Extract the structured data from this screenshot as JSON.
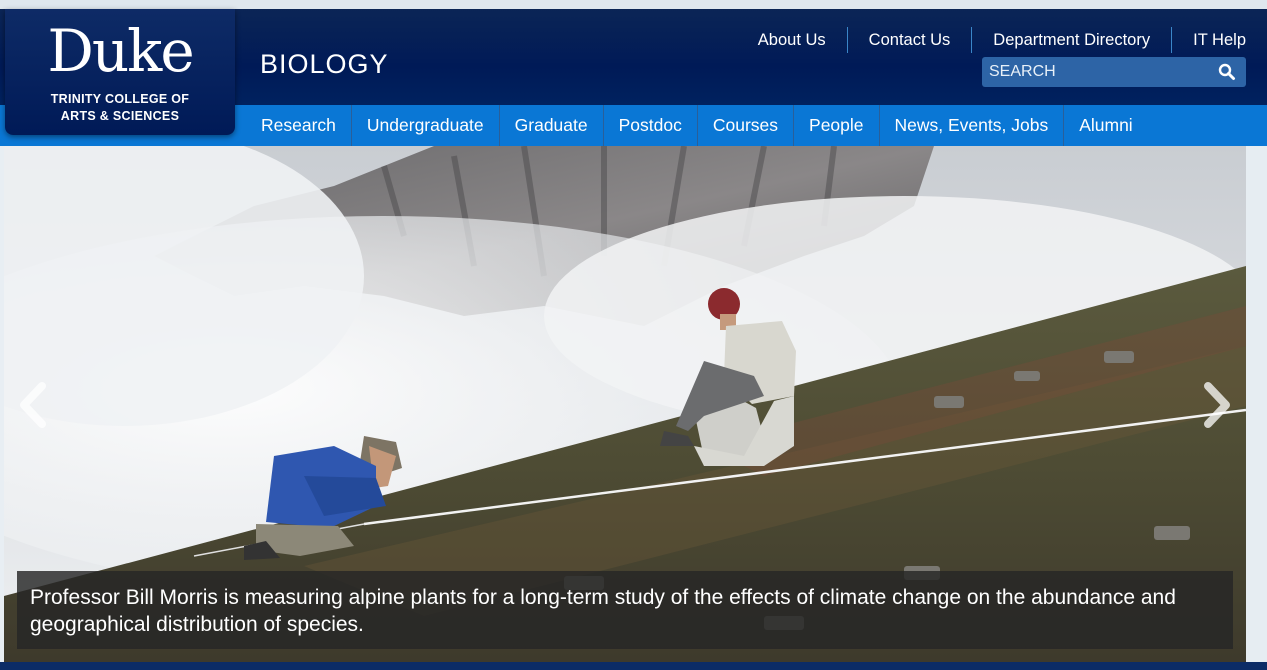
{
  "logo": {
    "wordmark": "Duke",
    "subtitle_line1": "TRINITY COLLEGE OF",
    "subtitle_line2": "ARTS & SCIENCES"
  },
  "site_title": "BIOLOGY",
  "utility_links": [
    "About Us",
    "Contact Us",
    "Department Directory",
    "IT Help"
  ],
  "search": {
    "placeholder": "SEARCH",
    "icon": "magnifier-icon"
  },
  "nav": {
    "items": [
      "Research",
      "Undergraduate",
      "Graduate",
      "Postdoc",
      "Courses",
      "People",
      "News, Events, Jobs",
      "Alumni"
    ]
  },
  "carousel": {
    "caption": "Professor Bill Morris is measuring alpine plants for a long-term study of the effects of climate change on the abundance and geographical distribution of species.",
    "prev_icon": "chevron-left-icon",
    "next_icon": "chevron-right-icon"
  },
  "colors": {
    "header_navy": "#001a57",
    "nav_blue": "#0a77d5",
    "search_blue": "#2d64a6"
  }
}
